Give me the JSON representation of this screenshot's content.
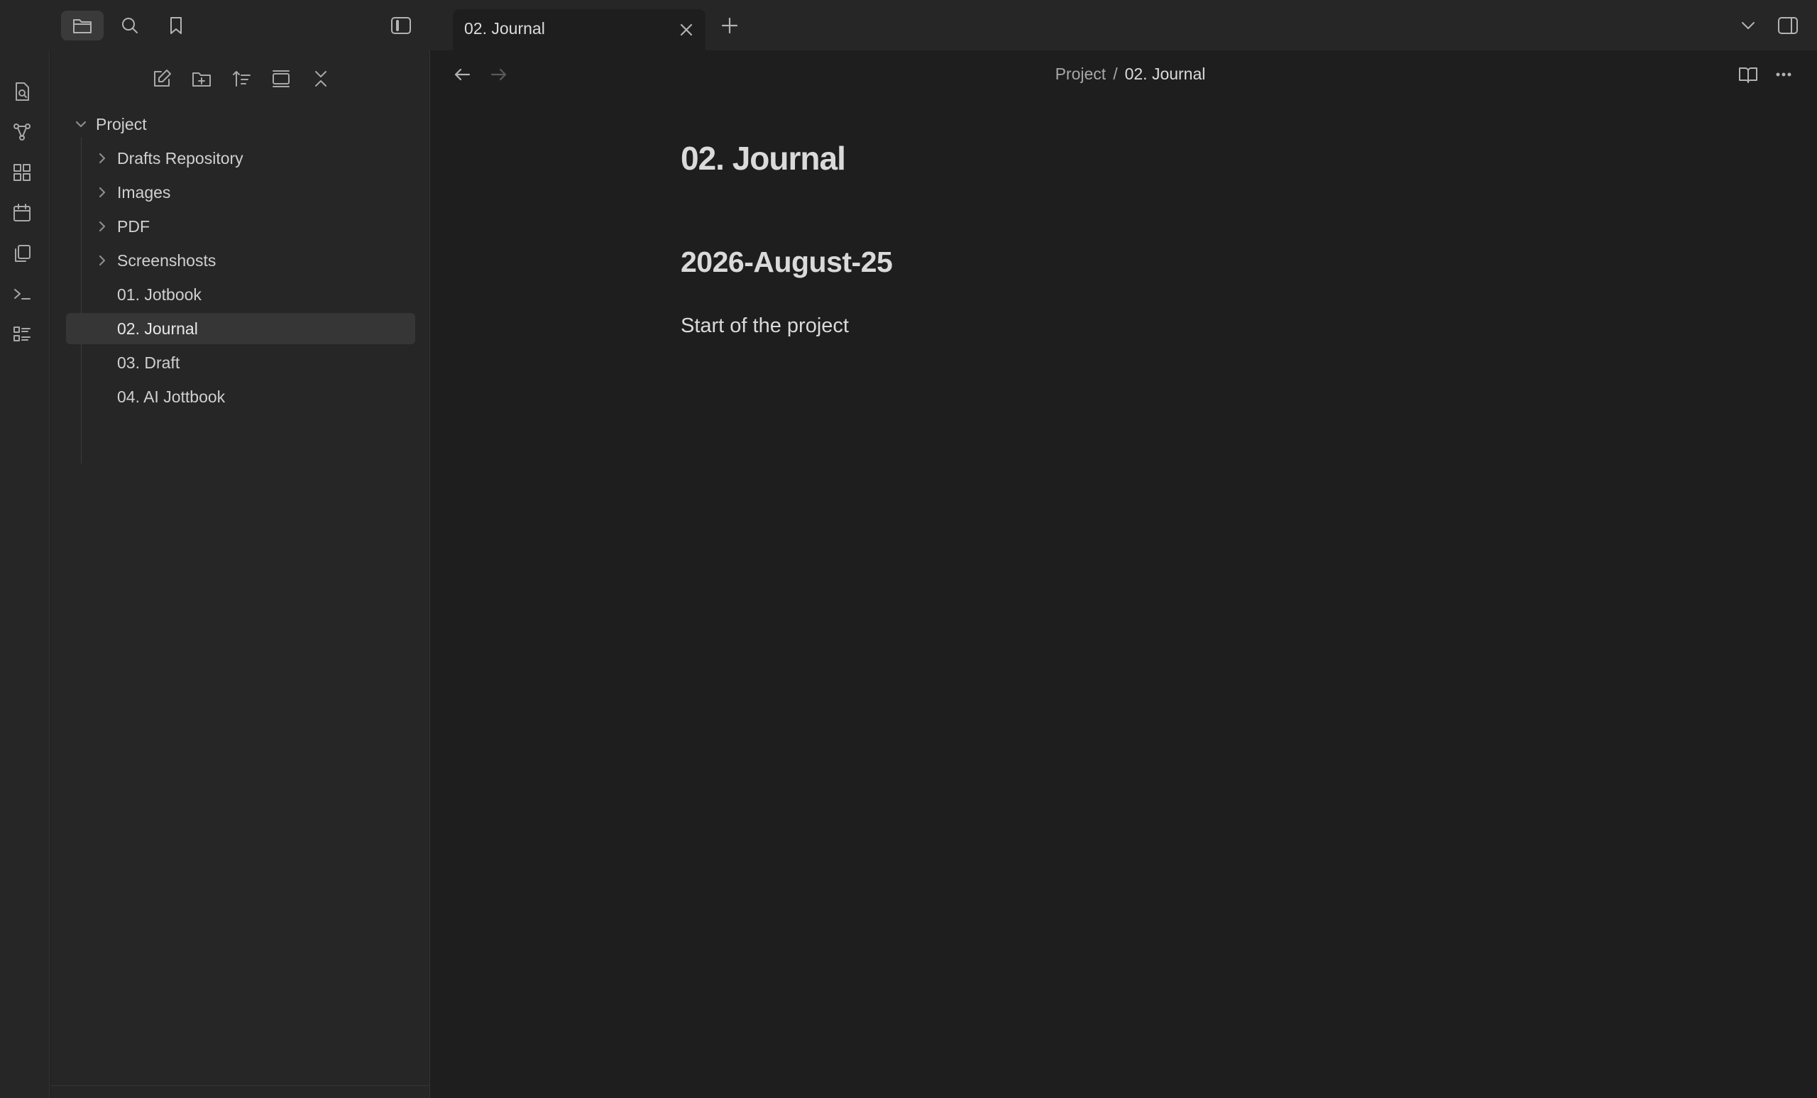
{
  "topbar": {
    "tab_title": "02. Journal",
    "icons": [
      "folder-icon",
      "search-icon",
      "bookmark-icon",
      "sidebar-toggle-icon",
      "close-icon",
      "plus-icon",
      "chevron-down-icon",
      "right-sidebar-icon"
    ]
  },
  "ribbon": {
    "icons": [
      "open-quick-switcher-icon",
      "graph-view-icon",
      "canvas-icon",
      "daily-notes-icon",
      "templates-icon",
      "command-palette-icon",
      "outline-icon"
    ]
  },
  "sidebar": {
    "actions": [
      "new-note-icon",
      "new-folder-icon",
      "sort-icon",
      "collapse-view-icon",
      "collapse-all-icon"
    ],
    "root": "Project",
    "items": [
      {
        "label": "Drafts Repository",
        "type": "folder"
      },
      {
        "label": "Images",
        "type": "folder"
      },
      {
        "label": "PDF",
        "type": "folder"
      },
      {
        "label": "Screenshosts",
        "type": "folder"
      },
      {
        "label": "01. Jotbook",
        "type": "file"
      },
      {
        "label": "02. Journal",
        "type": "file",
        "active": true
      },
      {
        "label": "03. Draft",
        "type": "file"
      },
      {
        "label": "04. AI Jottbook",
        "type": "file"
      }
    ]
  },
  "main": {
    "breadcrumb": {
      "parent": "Project",
      "separator": "/",
      "current": "02. Journal"
    },
    "note": {
      "title": "02. Journal",
      "heading": "2026-August-25",
      "body": "Start of the project"
    }
  },
  "colors": {
    "background": "#1e1e1e",
    "chrome": "#262626",
    "active_item": "#363636",
    "text": "#dadada"
  }
}
